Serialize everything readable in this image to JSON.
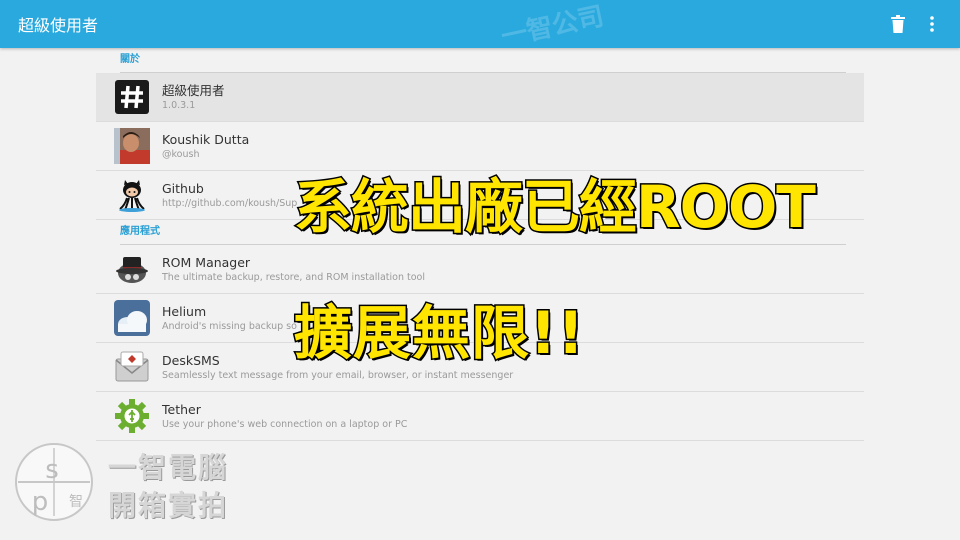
{
  "appbar": {
    "title": "超級使用者",
    "delete_icon": "trash-icon",
    "menu_icon": "overflow-menu-icon",
    "color": "#2aa9de"
  },
  "sections": [
    {
      "header": "關於"
    },
    {
      "header": "應用程式"
    }
  ],
  "about_items": [
    {
      "title": "超級使用者",
      "subtitle": "1.0.3.1",
      "icon": "hash-icon"
    },
    {
      "title": "Koushik Dutta",
      "subtitle": "@koush",
      "icon": "avatar"
    },
    {
      "title": "Github",
      "subtitle": "http://github.com/koush/Sup",
      "icon": "github-octocat-icon"
    }
  ],
  "app_items": [
    {
      "title": "ROM Manager",
      "subtitle": "The ultimate backup, restore, and ROM installation tool",
      "icon": "rom-manager-icon"
    },
    {
      "title": "Helium",
      "subtitle": "Android's missing backup so",
      "icon": "helium-cloud-icon"
    },
    {
      "title": "DeskSMS",
      "subtitle": "Seamlessly text message from your email, browser, or instant messenger",
      "icon": "desksms-mail-icon"
    },
    {
      "title": "Tether",
      "subtitle": "Use your phone's web connection on a laptop or PC",
      "icon": "tether-gear-icon"
    }
  ],
  "overlay": {
    "line1": "系統出廠已經ROOT",
    "line2": "擴展無限!!",
    "color": "#ffe500"
  },
  "watermark": {
    "line1": "一智電腦",
    "line2": "開箱實拍",
    "logo_char": "智",
    "logo_letters": "sp",
    "top_text": "一智公司"
  }
}
